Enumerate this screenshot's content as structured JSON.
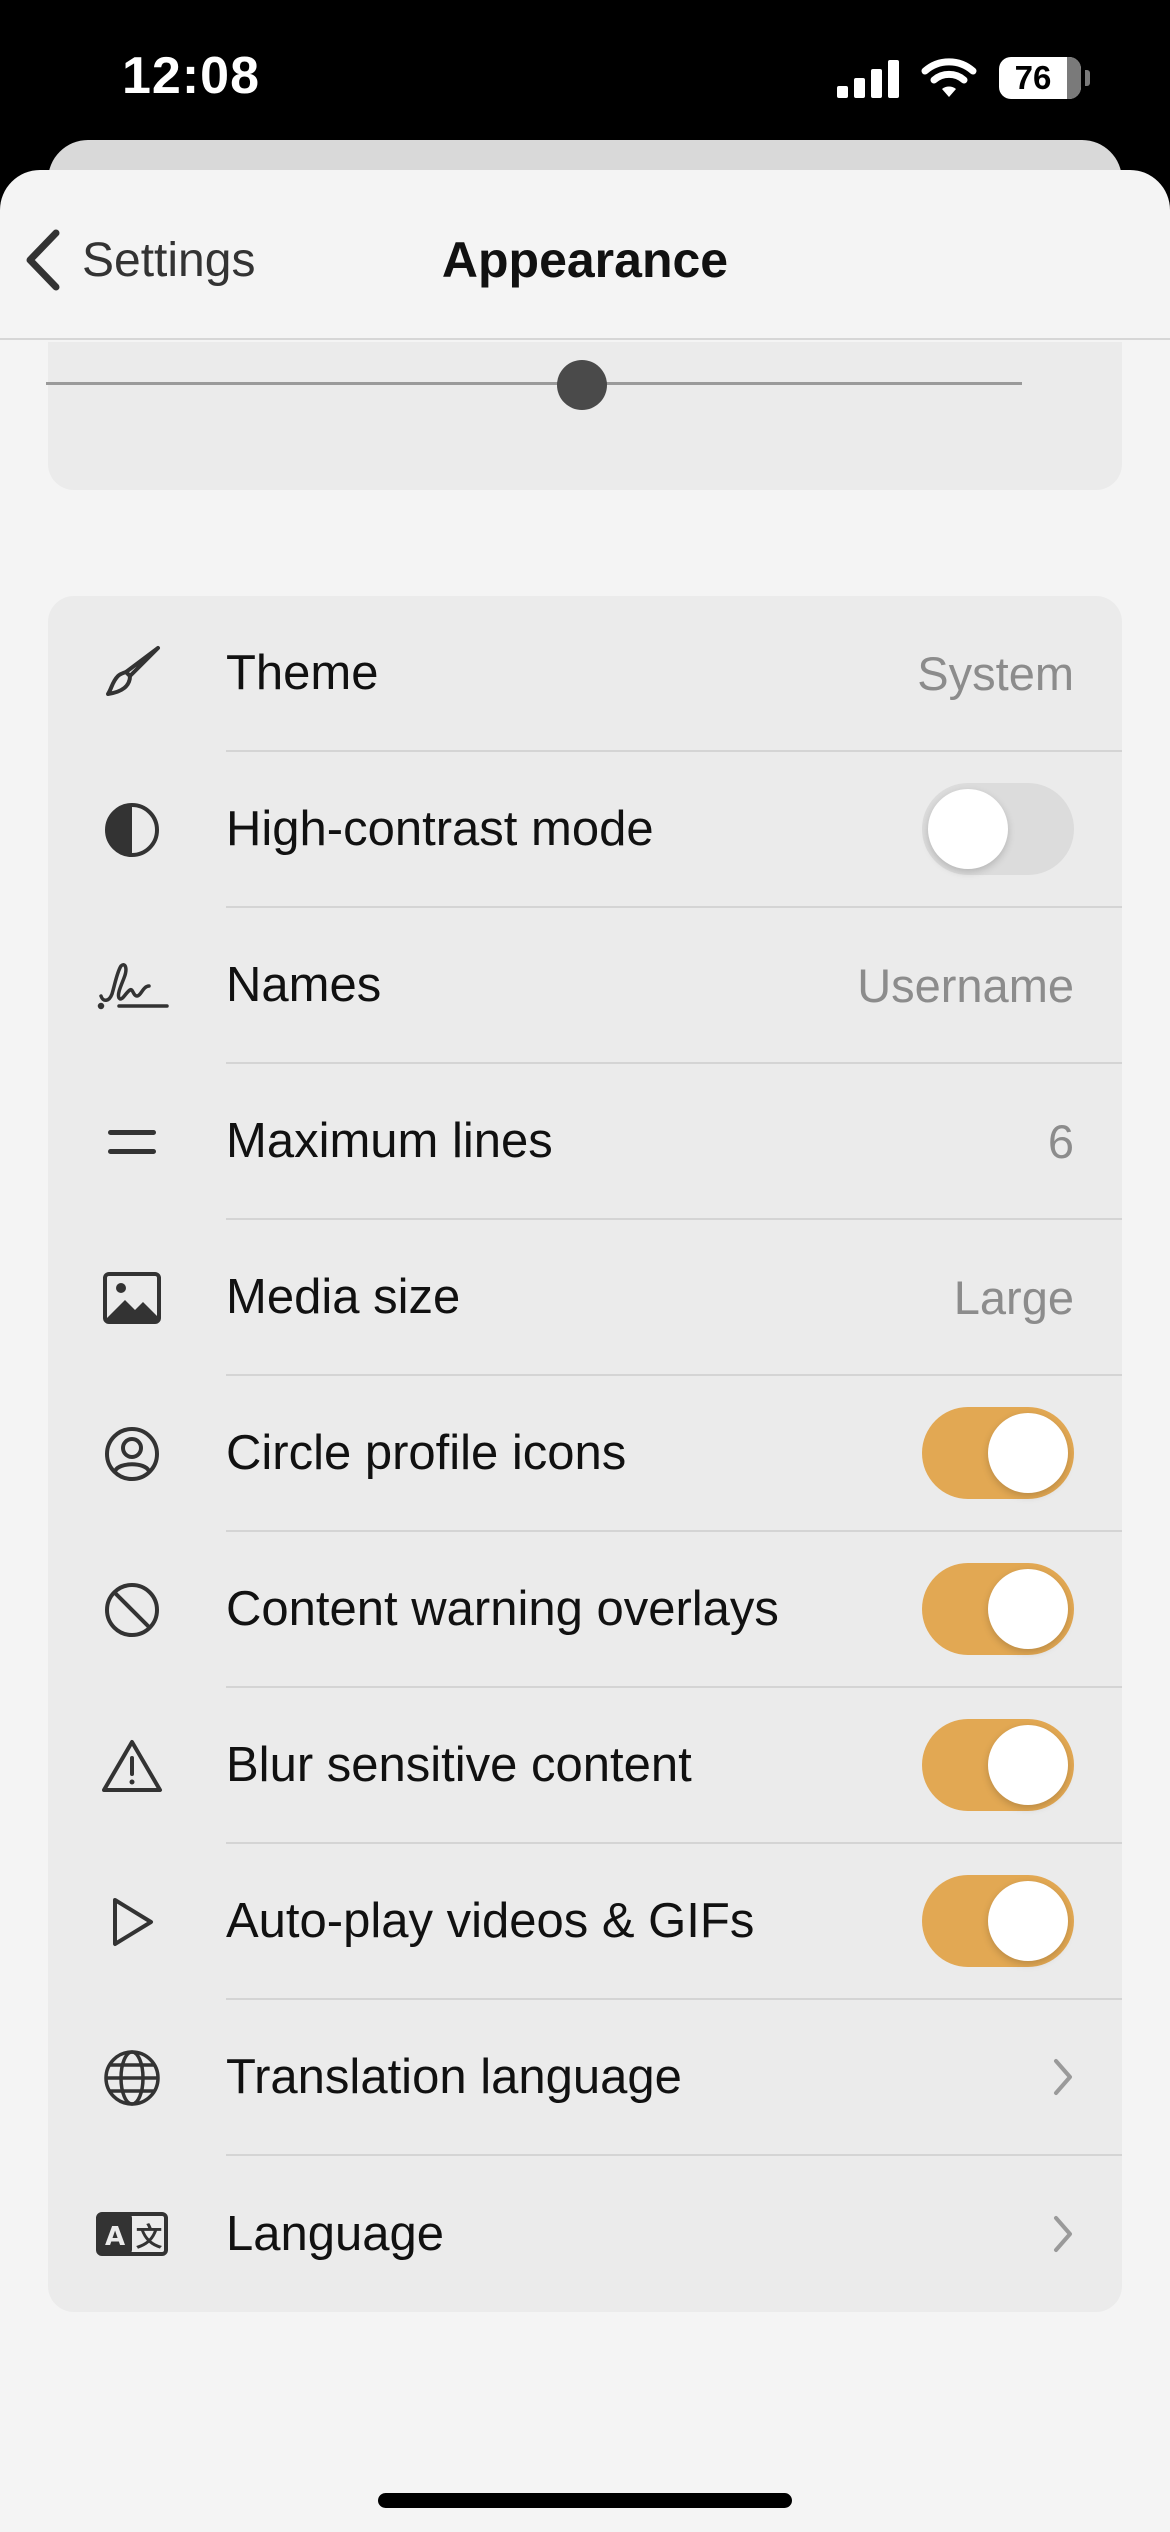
{
  "status_bar": {
    "time": "12:08",
    "battery": "76"
  },
  "nav": {
    "back_label": "Settings",
    "title": "Appearance"
  },
  "font_size_slider": {
    "value_fraction": 0.5
  },
  "settings": [
    {
      "icon": "paintbrush-icon",
      "label": "Theme",
      "type": "value",
      "value": "System"
    },
    {
      "icon": "contrast-icon",
      "label": "High-contrast mode",
      "type": "toggle",
      "on": false
    },
    {
      "icon": "signature-icon",
      "label": "Names",
      "type": "value",
      "value": "Username"
    },
    {
      "icon": "equals-icon",
      "label": "Maximum lines",
      "type": "value",
      "value": "6"
    },
    {
      "icon": "image-icon",
      "label": "Media size",
      "type": "value",
      "value": "Large"
    },
    {
      "icon": "user-circle-icon",
      "label": "Circle profile icons",
      "type": "toggle",
      "on": true
    },
    {
      "icon": "prohibited-icon",
      "label": "Content warning overlays",
      "type": "toggle",
      "on": true
    },
    {
      "icon": "warning-icon",
      "label": "Blur sensitive content",
      "type": "toggle",
      "on": true
    },
    {
      "icon": "play-icon",
      "label": "Auto-play videos & GIFs",
      "type": "toggle",
      "on": true
    },
    {
      "icon": "globe-icon",
      "label": "Translation language",
      "type": "chevron"
    },
    {
      "icon": "translate-icon",
      "label": "Language",
      "type": "chevron"
    }
  ],
  "colors": {
    "accent": "#e2a853",
    "card": "#ebebeb",
    "background": "#f4f4f4"
  }
}
